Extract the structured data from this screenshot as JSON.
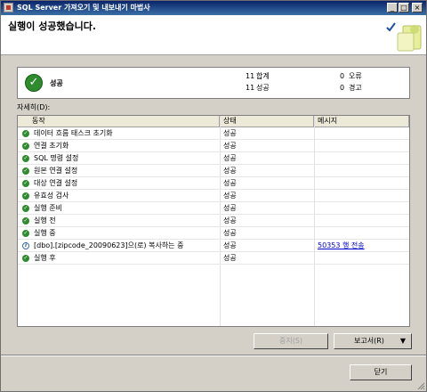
{
  "window": {
    "title": "SQL Server 가져오기 및 내보내기 마법사",
    "controls": {
      "minimize": "_",
      "maximize": "□",
      "close": "×"
    }
  },
  "header": {
    "title": "실행이 성공했습니다."
  },
  "summary": {
    "status_text": "성공",
    "total_count": "11",
    "total_label": "합계",
    "success_count": "11",
    "success_label": "성공",
    "error_count": "0",
    "error_label": "오류",
    "warning_count": "0",
    "warning_label": "경고",
    "status_icon": "success-check-icon"
  },
  "details": {
    "label": "자세히(D):",
    "columns": [
      "동작",
      "상태",
      "메시지"
    ],
    "rows": [
      {
        "icon": "check",
        "action": "데이터 흐름 태스크 초기화",
        "status": "성공",
        "message": ""
      },
      {
        "icon": "check",
        "action": "연결 초기화",
        "status": "성공",
        "message": ""
      },
      {
        "icon": "check",
        "action": "SQL 명령 설정",
        "status": "성공",
        "message": ""
      },
      {
        "icon": "check",
        "action": "원본 연결 설정",
        "status": "성공",
        "message": ""
      },
      {
        "icon": "check",
        "action": "대상 연결 설정",
        "status": "성공",
        "message": ""
      },
      {
        "icon": "check",
        "action": "유효성 검사",
        "status": "성공",
        "message": ""
      },
      {
        "icon": "check",
        "action": "실행 준비",
        "status": "성공",
        "message": ""
      },
      {
        "icon": "check",
        "action": "실행 전",
        "status": "성공",
        "message": ""
      },
      {
        "icon": "check",
        "action": "실행 중",
        "status": "성공",
        "message": ""
      },
      {
        "icon": "info",
        "action": "[dbo].[zipcode_20090623]으(로) 복사하는 중",
        "status": "성공",
        "message": "50353 행 전송"
      },
      {
        "icon": "check",
        "action": "실행 후",
        "status": "성공",
        "message": ""
      }
    ]
  },
  "buttons": {
    "stop": "중지(S)",
    "report": "보고서(R)",
    "report_arrow": "▼",
    "close": "닫기"
  },
  "colors": {
    "titlebar": "#0a246a",
    "success": "#2e8b2e",
    "link": "#0000cc"
  }
}
